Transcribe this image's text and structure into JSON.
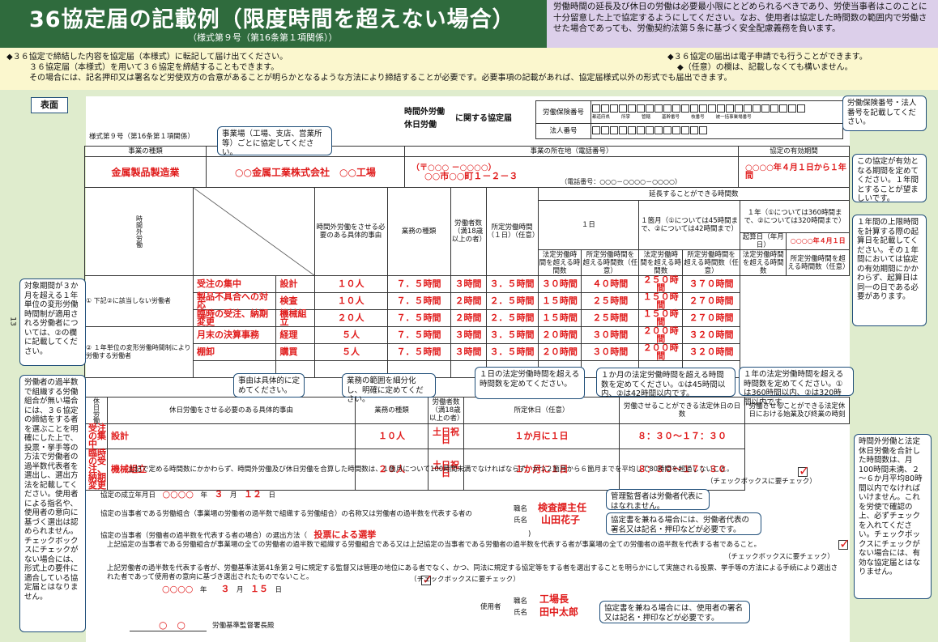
{
  "header": {
    "title": "36協定届の記載例（限度時間を超えない場合）",
    "subtitle": "（様式第９号（第16条第１項関係））"
  },
  "notice": "労働時間の延長及び休日の労働は必要最小限にとどめられるべきであり、労使当事者はこのことに十分留意した上で協定するようにしてください。なお、使用者は協定した時間数の範囲内で労働させた場合であっても、労働契約法第５条に基づく安全配慮義務を負います。",
  "band": {
    "l1": "◆３６協定で締結した内容を協定届（本様式）に転記して届け出てください。",
    "l2": "３６協定届（本様式）を用いて３６協定を締結することもできます。",
    "l3": "その場合には、記名押印又は署名など労使双方の合意があることが明らかとなるような方法により締結することが必要です。必要事項の記載があれば、協定届様式以外の形式でも届出できます。",
    "r1": "◆３６協定の届出は電子申請でも行うことができます。",
    "r2": "◆（任意）の欄は、記載しなくても構いません。"
  },
  "tab": "表面",
  "form": {
    "form_no": "様式第９号（第16条第１項関係）",
    "title_a": "時間外労働",
    "title_b": "休日労働",
    "title_c": "に関する協定届",
    "insurance_label": "労働保険番号",
    "corp_label": "法人番号",
    "ins_sub": [
      "都道府県",
      "所掌",
      "管轄",
      "基幹番号",
      "枝番号",
      "被一括事業場番号"
    ],
    "h_kind": "事業の種類",
    "h_name": "事業の名称",
    "h_addr": "事業の所在地（電話番号）",
    "h_period": "協定の有効期間",
    "kind": "金属製品製造業",
    "name": "○○金属工業株式会社　○○工場",
    "zip": "（〒○○○ －○○○○）",
    "addr": "○○市○○町１－２－３",
    "tel": "（電話番号：○○○－○○○○－○○○○）",
    "period": "○○○○年４月１日から１年間",
    "ot": {
      "side": "時間外労働",
      "h_reason": "時間外労働をさせる必要のある具体的事由",
      "h_job": "業務の種類",
      "h_count": "労働者数（満18歳以上の者）",
      "h_fixed": "所定労働時間（１日）（任意）",
      "h_ext": "延長することができる時間数",
      "h_day": "１日",
      "h_month": "１箇月（①については45時間まで、②については42時間まで）",
      "h_year": "１年（①については360時間まで、②については320時間まで）",
      "h_start": "起算日（年月日）",
      "start": "○○○○年４月１日",
      "h_legal": "法定労働時間を超える時間数",
      "h_fixedover": "所定労働時間を超える時間数（任意）",
      "row1_label": "① 下記②に該当しない労働者",
      "row2_label": "② １年単位の変形労働時間制により労働する労働者",
      "rows": [
        {
          "reason": "受注の集中",
          "job": "設計",
          "count": "１０人",
          "fixed": "７．５時間",
          "d1": "３時間",
          "d2": "３．５時間",
          "m1": "３０時間",
          "m2": "４０時間",
          "y1": "２５０時間",
          "y2": "３７０時間"
        },
        {
          "reason": "製品不具合への対応",
          "job": "検査",
          "count": "１０人",
          "fixed": "７．５時間",
          "d1": "２時間",
          "d2": "２．５時間",
          "m1": "１５時間",
          "m2": "２５時間",
          "y1": "１５０時間",
          "y2": "２７０時間"
        },
        {
          "reason": "臨時の受注、納期変更",
          "job": "機械組立",
          "count": "２０人",
          "fixed": "７．５時間",
          "d1": "２時間",
          "d2": "２．５時間",
          "m1": "１５時間",
          "m2": "２５時間",
          "y1": "１５０時間",
          "y2": "２７０時間"
        },
        {
          "reason": "月末の決算事務",
          "job": "経理",
          "count": "５人",
          "fixed": "７．５時間",
          "d1": "３時間",
          "d2": "３．５時間",
          "m1": "２０時間",
          "m2": "３０時間",
          "y1": "２００時間",
          "y2": "３２０時間"
        },
        {
          "reason": "棚卸",
          "job": "購買",
          "count": "５人",
          "fixed": "７．５時間",
          "d1": "３時間",
          "d2": "３．５時間",
          "m1": "２０時間",
          "m2": "３０時間",
          "y1": "２００時間",
          "y2": "３２０時間"
        }
      ]
    },
    "hol": {
      "side": "休日労働",
      "h_reason": "休日労働をさせる必要のある具体的事由",
      "h_job": "業務の種類",
      "h_count": "労働者数（満18歳以上の者）",
      "h_day": "所定休日（任意）",
      "h_times": "労働させることができる法定休日の日数",
      "h_hours": "労働させることができる法定休日における始業及び終業の時刻",
      "rows": [
        {
          "reason": "受注の集中",
          "job": "設計",
          "count": "１０人",
          "day": "土日祝日",
          "times": "１か月に１日",
          "hours": "８：３０～１７：３０"
        },
        {
          "reason": "臨時の受注、納期変更",
          "job": "機械組立",
          "count": "２０人",
          "day": "土日祝日",
          "times": "１か月に１日",
          "hours": "８：３０～１７：３０"
        }
      ]
    },
    "limit_text": "上記で定める時間数にかかわらず、時間外労働及び休日労働を合算した時間数は、１箇月について100時間未満でなければならず、かつ２箇月から６箇月までを平均して80時間を超過しないこと。",
    "check_note": "（チェックボックスに要チェック）",
    "est_label": "協定の成立年月日",
    "est_y": "○○○○",
    "est_m": "３",
    "est_d": "１２",
    "nen": "年",
    "tsuki": "月",
    "hi": "日",
    "party_label": "協定の当事者である労働組合（事業場の労働者の過半数で組織する労働組合）の名称又は労働者の過半数を代表する者の",
    "shoku": "職名",
    "shimei": "氏名",
    "w_title": "検査課主任",
    "w_name": "山田花子",
    "method_label": "協定の当事者（労働者の過半数を代表する者の場合）の選出方法（",
    "method": "投票による選挙",
    "union_text": "上記協定の当事者である労働組合が事業場の全ての労働者の過半数で組織する労働組合である又は上記協定の当事者である労働者の過半数を代表する者が事業場の全ての労働者の過半数を代表する者であること。",
    "rep_text": "上記労働者の過半数を代表する者が、労働基準法第41条第２号に規定する監督又は管理の地位にある者でなく、かつ、同法に規定する協定等をする者を選出することを明らかにして実施される投票、挙手等の方法による手続により選出された者であって使用者の意向に基づき選出されたものでないこと。",
    "date2_y": "○○○○",
    "date2_m": "３",
    "date2_d": "１５",
    "employer": "使用者",
    "e_title": "工場長",
    "e_name": "田中太郎",
    "office": "○　○",
    "office_label": "労働基準監督署長殿"
  },
  "callouts": {
    "c_ins": "労働保険番号・法人番号を記載してください。",
    "c_unit": "事業場（工場、支店、営業所等）ごとに協定してください。",
    "c_period": "この協定が有効となる期間を定めてください。１年間とすることが望ましいです。",
    "c_start": "１年間の上限時間を計算する際の起算日を記載してください。その１年間においては協定の有効期間にかかわらず、起算日は同一の日である必要があります。",
    "c_var": "対象期間が３か月を超える１年単位の変形労働時間制が適用される労働者については、②の欄に記載してください。",
    "c_rep": "労働者の過半数で組織する労働組合が無い場合には、３６協定の締結をする者を選ぶことを明確にした上で、投票・挙手等の方法で労働者の過半数代表者を選出し、選出方法を記載してください。使用者による指名や、使用者の意向に基づく選出は認められません。チェックボックスにチェックがない場合には、形式上の要件に適合している協定届とはなりません。",
    "c_reason": "事由は具体的に定めてください。",
    "c_job": "業務の範囲を細分化し、明確に定めてください。",
    "c_day": "１日の法定労働時間を超える時間数を定めてください。",
    "c_month": "１か月の法定労働時間を超える時間数を定めてください。①は45時間以内、②は42時間以内です。",
    "c_year": "１年の法定労働時間を超える時間数を定めてください。①は360時間以内、②は320時間以内です。",
    "c_total": "時間外労働と法定休日労働を合計した時間数は、月100時間未満、２～６か月平均80時間以内でなければいけません。これを労使で確認の上、必ずチェックを入れてください。チェックボックスにチェックがない場合には、有効な協定届とはなりません。",
    "c_mgr": "管理監督者は労働者代表にはなれません。",
    "c_sign_w": "協定書を兼ねる場合には、労働者代表の署名又は記名・押印などが必要です。",
    "c_sign_e": "協定書を兼ねる場合には、使用者の署名又は記名・押印などが必要です。"
  },
  "page_no": "13"
}
